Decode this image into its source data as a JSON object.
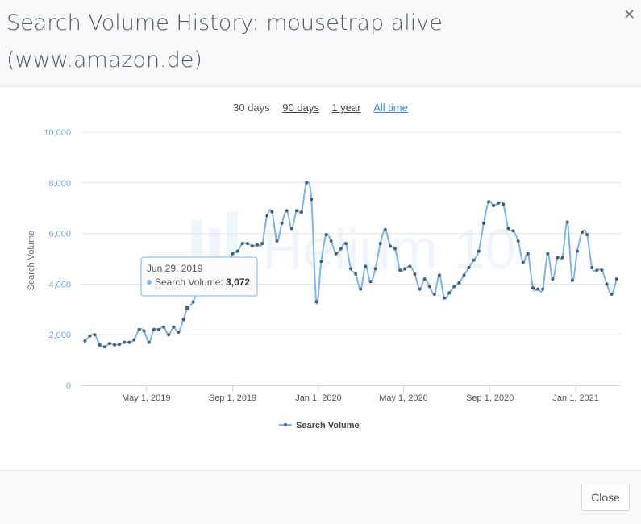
{
  "header": {
    "title_line1": "Search Volume History: mousetrap alive",
    "title_line2": "(www.amazon.de)"
  },
  "ranges": [
    {
      "label": "30 days"
    },
    {
      "label": "90 days"
    },
    {
      "label": "1 year"
    },
    {
      "label": "All time"
    }
  ],
  "footer": {
    "close_label": "Close"
  },
  "watermark": "Helium 10",
  "tooltip": {
    "date": "Jun 29, 2019",
    "series": "Search Volume: ",
    "value": "3,072"
  },
  "colors": {
    "line": "#7cb5ec",
    "marker": "#4a5d73",
    "grid": "#e6e6e6",
    "axis_label": "#6ea8dc"
  },
  "chart_data": {
    "type": "line",
    "ylabel": "Search Volume",
    "ylim": [
      0,
      10000
    ],
    "y_ticks": [
      0,
      2000,
      4000,
      6000,
      8000,
      10000
    ],
    "y_tick_labels": [
      "0",
      "2,000",
      "4,000",
      "6,000",
      "8,000",
      "10,000"
    ],
    "x_ticks": [
      "2019-05-01",
      "2019-09-01",
      "2020-01-01",
      "2020-05-01",
      "2020-09-01",
      "2021-01-01"
    ],
    "x_tick_labels": [
      "May 1, 2019",
      "Sep 1, 2019",
      "Jan 1, 2020",
      "May 1, 2020",
      "Sep 1, 2020",
      "Jan 1, 2021"
    ],
    "series": [
      {
        "name": "Search Volume",
        "points": [
          [
            "2019-02-03",
            1750
          ],
          [
            "2019-02-10",
            1950
          ],
          [
            "2019-02-17",
            2000
          ],
          [
            "2019-02-24",
            1600
          ],
          [
            "2019-03-03",
            1520
          ],
          [
            "2019-03-10",
            1650
          ],
          [
            "2019-03-17",
            1600
          ],
          [
            "2019-03-24",
            1620
          ],
          [
            "2019-03-31",
            1700
          ],
          [
            "2019-04-07",
            1700
          ],
          [
            "2019-04-14",
            1800
          ],
          [
            "2019-04-21",
            2200
          ],
          [
            "2019-04-28",
            2150
          ],
          [
            "2019-05-05",
            1700
          ],
          [
            "2019-05-12",
            2200
          ],
          [
            "2019-05-19",
            2200
          ],
          [
            "2019-05-26",
            2300
          ],
          [
            "2019-06-02",
            2000
          ],
          [
            "2019-06-09",
            2300
          ],
          [
            "2019-06-16",
            2100
          ],
          [
            "2019-06-23",
            2600
          ],
          [
            "2019-06-29",
            3072
          ],
          [
            "2019-07-07",
            3300
          ],
          [
            "2019-07-14",
            3900
          ],
          [
            "2019-07-21",
            3800
          ],
          [
            "2019-07-28",
            3800
          ],
          [
            "2019-08-04",
            4200
          ],
          [
            "2019-08-11",
            5000
          ],
          [
            "2019-08-18",
            4700
          ],
          [
            "2019-08-25",
            4600
          ],
          [
            "2019-09-01",
            5200
          ],
          [
            "2019-09-08",
            5300
          ],
          [
            "2019-09-15",
            5600
          ],
          [
            "2019-09-22",
            5600
          ],
          [
            "2019-09-29",
            5500
          ],
          [
            "2019-10-06",
            5550
          ],
          [
            "2019-10-13",
            5600
          ],
          [
            "2019-10-20",
            6700
          ],
          [
            "2019-10-27",
            6850
          ],
          [
            "2019-11-03",
            5700
          ],
          [
            "2019-11-10",
            6400
          ],
          [
            "2019-11-17",
            6900
          ],
          [
            "2019-11-24",
            6200
          ],
          [
            "2019-12-01",
            6900
          ],
          [
            "2019-12-08",
            6850
          ],
          [
            "2019-12-15",
            8000
          ],
          [
            "2019-12-22",
            7350
          ],
          [
            "2019-12-29",
            3300
          ],
          [
            "2020-01-05",
            4900
          ],
          [
            "2020-01-12",
            5950
          ],
          [
            "2020-01-19",
            5700
          ],
          [
            "2020-01-26",
            5200
          ],
          [
            "2020-02-02",
            5400
          ],
          [
            "2020-02-09",
            5600
          ],
          [
            "2020-02-16",
            4600
          ],
          [
            "2020-02-23",
            4400
          ],
          [
            "2020-03-01",
            3800
          ],
          [
            "2020-03-08",
            4700
          ],
          [
            "2020-03-15",
            4100
          ],
          [
            "2020-03-22",
            4600
          ],
          [
            "2020-03-29",
            5600
          ],
          [
            "2020-04-05",
            6150
          ],
          [
            "2020-04-12",
            5500
          ],
          [
            "2020-04-19",
            5400
          ],
          [
            "2020-04-26",
            4550
          ],
          [
            "2020-05-03",
            4600
          ],
          [
            "2020-05-10",
            4700
          ],
          [
            "2020-05-17",
            4400
          ],
          [
            "2020-05-24",
            3800
          ],
          [
            "2020-05-31",
            4200
          ],
          [
            "2020-06-07",
            3900
          ],
          [
            "2020-06-14",
            3600
          ],
          [
            "2020-06-21",
            4350
          ],
          [
            "2020-06-28",
            3450
          ],
          [
            "2020-07-05",
            3650
          ],
          [
            "2020-07-12",
            3900
          ],
          [
            "2020-07-19",
            4050
          ],
          [
            "2020-07-26",
            4350
          ],
          [
            "2020-08-02",
            4650
          ],
          [
            "2020-08-09",
            4950
          ],
          [
            "2020-08-16",
            5300
          ],
          [
            "2020-08-23",
            6400
          ],
          [
            "2020-08-30",
            7250
          ],
          [
            "2020-09-06",
            7100
          ],
          [
            "2020-09-13",
            7200
          ],
          [
            "2020-09-20",
            7150
          ],
          [
            "2020-09-27",
            6200
          ],
          [
            "2020-10-04",
            6100
          ],
          [
            "2020-10-11",
            5700
          ],
          [
            "2020-10-18",
            4850
          ],
          [
            "2020-10-25",
            5200
          ],
          [
            "2020-11-01",
            3850
          ],
          [
            "2020-11-08",
            3800
          ],
          [
            "2020-11-15",
            3800
          ],
          [
            "2020-11-22",
            5200
          ],
          [
            "2020-11-29",
            4200
          ],
          [
            "2020-12-06",
            5050
          ],
          [
            "2020-12-13",
            5050
          ],
          [
            "2020-12-20",
            6450
          ],
          [
            "2020-12-27",
            4150
          ],
          [
            "2021-01-03",
            5300
          ],
          [
            "2021-01-10",
            6050
          ],
          [
            "2021-01-17",
            5950
          ],
          [
            "2021-01-24",
            4650
          ],
          [
            "2021-01-31",
            4550
          ],
          [
            "2021-02-07",
            4550
          ],
          [
            "2021-02-14",
            4000
          ],
          [
            "2021-02-21",
            3600
          ],
          [
            "2021-02-28",
            4200
          ]
        ]
      }
    ]
  }
}
